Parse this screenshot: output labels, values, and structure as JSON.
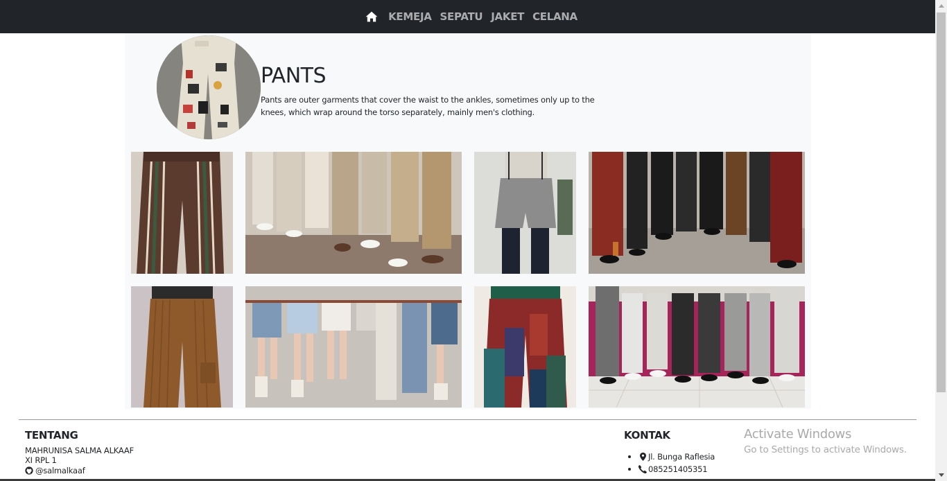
{
  "nav": {
    "home_icon": "home-icon",
    "items": [
      {
        "label": "KEMEJA"
      },
      {
        "label": "SEPATU"
      },
      {
        "label": "JAKET"
      },
      {
        "label": "CELANA"
      }
    ]
  },
  "hero": {
    "title": "PANTS",
    "description": "Pants are outer garments that cover the waist to the ankles, sometimes only up to the knees, which wrap around the torso separately, mainly men's clothing."
  },
  "footer": {
    "about_title": "TENTANG",
    "about_name": "MAHRUNISA SALMA ALKAAF",
    "about_class": "XI RPL 1",
    "about_github": "@salmalkaaf",
    "contact_title": "KONTAK",
    "contact_items": [
      {
        "icon": "map-pin-icon",
        "text": "Jl. Bunga Raflesia"
      },
      {
        "icon": "phone-icon",
        "text": "085251405351"
      }
    ]
  },
  "watermark": {
    "title": "Activate Windows",
    "subtitle": "Go to Settings to activate Windows."
  },
  "colors": {
    "navbar": "#212529",
    "nav_text": "#9d9d9d",
    "hero_bg": "#f8f9fa",
    "text": "#212529"
  }
}
